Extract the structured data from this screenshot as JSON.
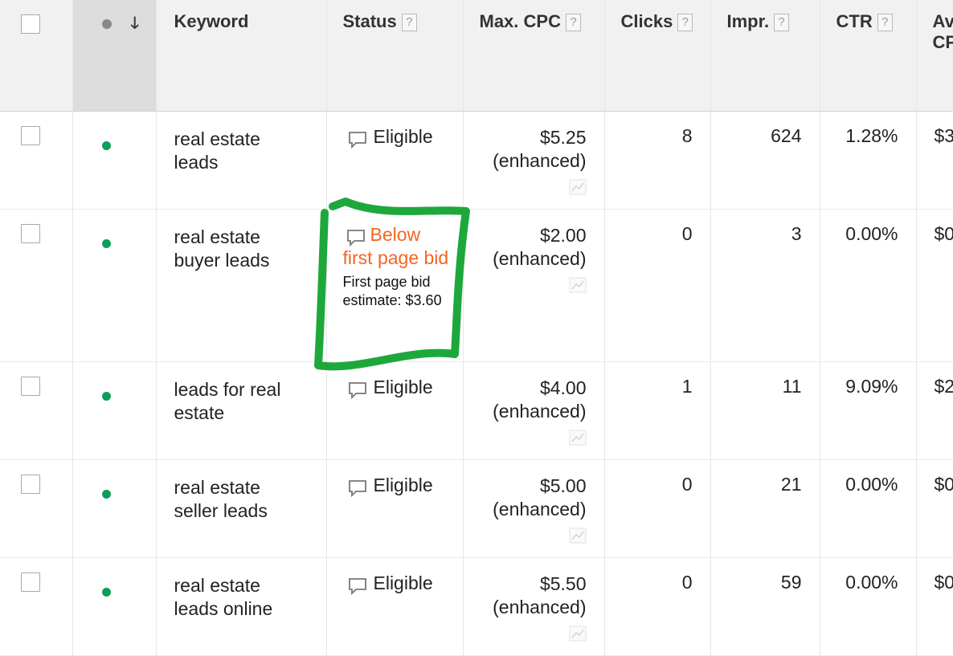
{
  "header": {
    "keyword": "Keyword",
    "status": "Status",
    "max_cpc": "Max. CPC",
    "clicks": "Clicks",
    "impr": "Impr.",
    "ctr": "CTR",
    "avg_cpc": "Avg. CPC",
    "help": "?"
  },
  "rows": [
    {
      "keyword": "real estate leads",
      "status": "Eligible",
      "max_cpc": "$5.25",
      "cpc_note": "(enhanced)",
      "clicks": "8",
      "impr": "624",
      "ctr": "1.28%",
      "avg_cpc": "$3"
    },
    {
      "keyword": "real estate buyer leads",
      "status": "Below first page bid",
      "status_note": "First page bid estimate: $3.60",
      "max_cpc": "$2.00",
      "cpc_note": "(enhanced)",
      "clicks": "0",
      "impr": "3",
      "ctr": "0.00%",
      "avg_cpc": "$0"
    },
    {
      "keyword": "leads for real estate",
      "status": "Eligible",
      "max_cpc": "$4.00",
      "cpc_note": "(enhanced)",
      "clicks": "1",
      "impr": "11",
      "ctr": "9.09%",
      "avg_cpc": "$2"
    },
    {
      "keyword": "real estate seller leads",
      "status": "Eligible",
      "max_cpc": "$5.00",
      "cpc_note": "(enhanced)",
      "clicks": "0",
      "impr": "21",
      "ctr": "0.00%",
      "avg_cpc": "$0"
    },
    {
      "keyword": "real estate leads online",
      "status": "Eligible",
      "max_cpc": "$5.50",
      "cpc_note": "(enhanced)",
      "clicks": "0",
      "impr": "59",
      "ctr": "0.00%",
      "avg_cpc": "$0"
    }
  ],
  "colors": {
    "keyword_enabled_dot": "#0c9d58",
    "warning_status": "#f26522",
    "annotation_marker": "#1ea83c"
  },
  "icons": {
    "status": "speech-bubble-icon",
    "bid_simulator": "line-graph-icon",
    "sort": "down-arrow-icon"
  }
}
